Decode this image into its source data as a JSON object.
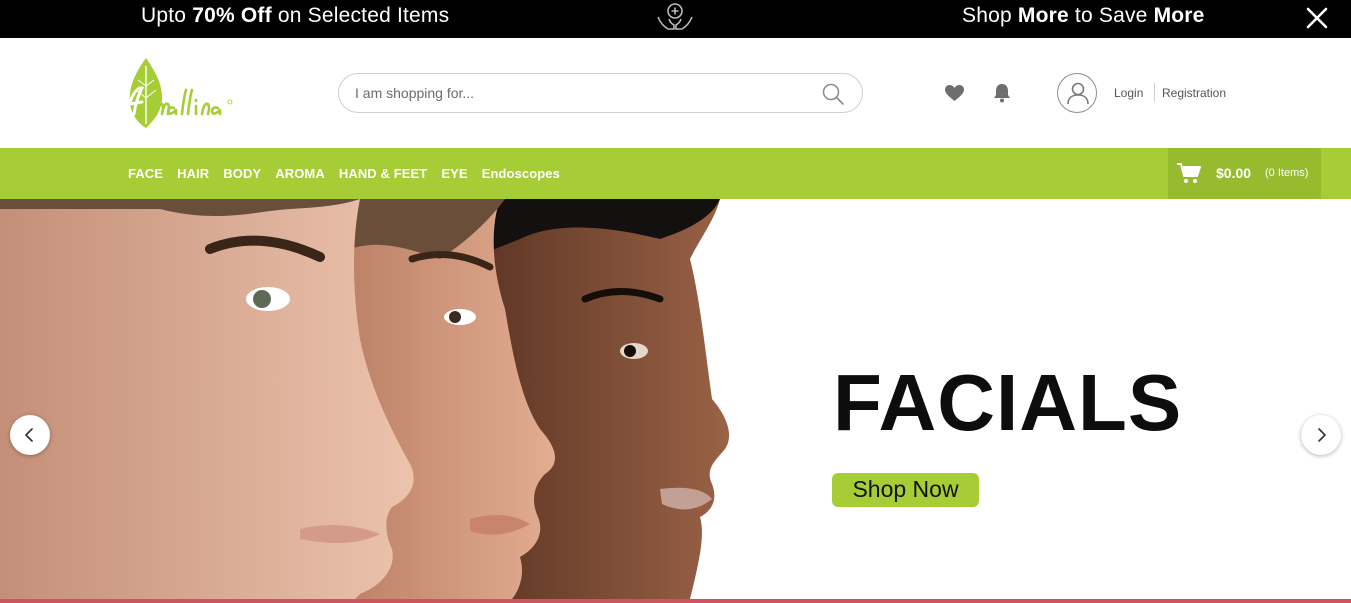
{
  "promo": {
    "left_prefix": "Upto ",
    "left_bold": "70% Off",
    "left_suffix": " on Selected Items",
    "right_prefix": "Shop ",
    "right_bold1": "More",
    "right_middle": " to Save ",
    "right_bold2": "More",
    "center_icon": "care-hands-icon",
    "close_icon": "close-icon"
  },
  "header": {
    "logo_text": "Amallina",
    "search": {
      "placeholder": "I am shopping for..."
    },
    "icons": [
      "heart-icon",
      "bell-icon",
      "user-icon",
      "search-icon"
    ],
    "login_label": "Login",
    "register_label": "Registration"
  },
  "nav": {
    "categories": [
      "FACE",
      "HAIR",
      "BODY",
      "AROMA",
      "HAND & FEET",
      "EYE",
      "Endoscopes"
    ],
    "cart_total": "$0.00",
    "cart_items": "(0 Items)"
  },
  "hero": {
    "title": "FACIALS",
    "cta_label": "Shop Now"
  },
  "colors": {
    "accent_green": "#a6cd35",
    "cart_green": "#96bb2e",
    "promo_bg": "#000000"
  }
}
